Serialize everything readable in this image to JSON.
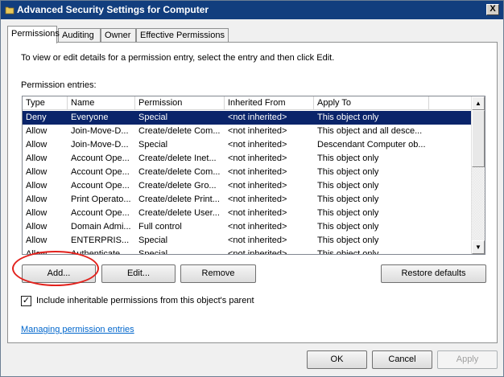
{
  "window": {
    "title": "Advanced Security Settings for Computer",
    "close_glyph": "X"
  },
  "tabs": [
    {
      "label": "Permissions",
      "active": true
    },
    {
      "label": "Auditing",
      "active": false
    },
    {
      "label": "Owner",
      "active": false
    },
    {
      "label": "Effective Permissions",
      "active": false
    }
  ],
  "panel": {
    "instructions": "To view or edit details for a permission entry, select the entry and then click Edit.",
    "entries_label": "Permission entries:"
  },
  "table": {
    "columns": [
      "Type",
      "Name",
      "Permission",
      "Inherited From",
      "Apply To"
    ],
    "rows": [
      [
        "Deny",
        "Everyone",
        "Special",
        "<not inherited>",
        "This object only"
      ],
      [
        "Allow",
        "Join-Move-D...",
        "Create/delete Com...",
        "<not inherited>",
        "This object and all desce..."
      ],
      [
        "Allow",
        "Join-Move-D...",
        "Special",
        "<not inherited>",
        "Descendant Computer ob..."
      ],
      [
        "Allow",
        "Account Ope...",
        "Create/delete Inet...",
        "<not inherited>",
        "This object only"
      ],
      [
        "Allow",
        "Account Ope...",
        "Create/delete Com...",
        "<not inherited>",
        "This object only"
      ],
      [
        "Allow",
        "Account Ope...",
        "Create/delete Gro...",
        "<not inherited>",
        "This object only"
      ],
      [
        "Allow",
        "Print Operato...",
        "Create/delete Print...",
        "<not inherited>",
        "This object only"
      ],
      [
        "Allow",
        "Account Ope...",
        "Create/delete User...",
        "<not inherited>",
        "This object only"
      ],
      [
        "Allow",
        "Domain Admi...",
        "Full control",
        "<not inherited>",
        "This object only"
      ],
      [
        "Allow",
        "ENTERPRIS...",
        "Special",
        "<not inherited>",
        "This object only"
      ],
      [
        "Allow",
        "Authenticate...",
        "Special",
        "<not inherited>",
        "This object only"
      ]
    ],
    "selected_row": 0
  },
  "buttons": {
    "add": "Add...",
    "edit": "Edit...",
    "remove": "Remove",
    "restore_defaults": "Restore defaults",
    "ok": "OK",
    "cancel": "Cancel",
    "apply": "Apply"
  },
  "checkbox": {
    "label": "Include inheritable permissions from this object's parent",
    "checked": true,
    "glyph": "✓"
  },
  "link": {
    "text": "Managing permission entries"
  },
  "scrollbar": {
    "up_glyph": "▲",
    "down_glyph": "▼"
  },
  "colors": {
    "title_bar": "#123e7e",
    "selection": "#0a246a",
    "annotation_circle": "#e2211c",
    "link": "#0066cc"
  }
}
